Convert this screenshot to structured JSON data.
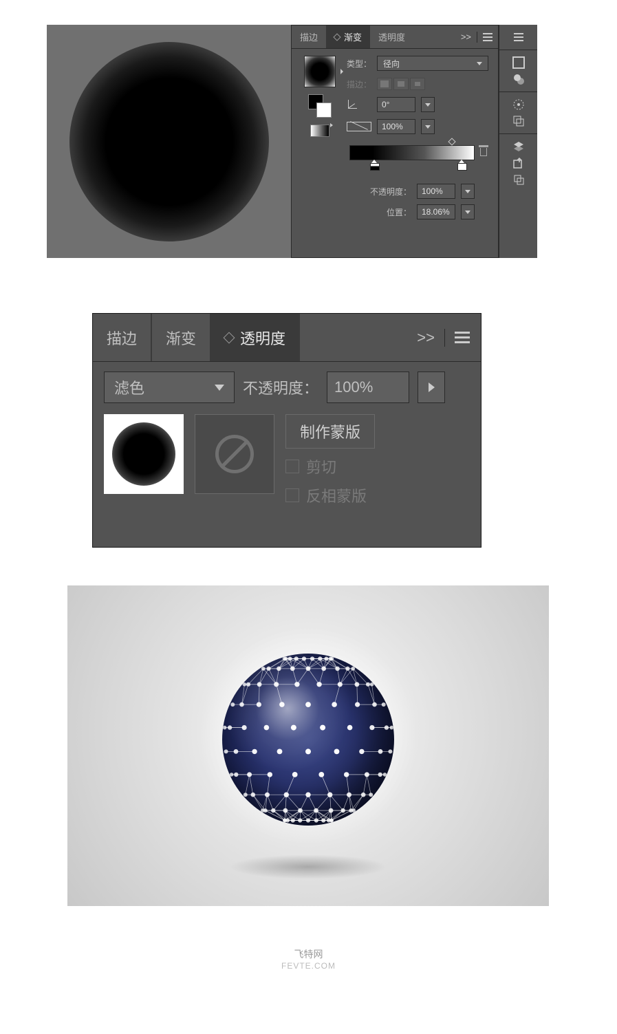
{
  "panel1": {
    "tabs": {
      "stroke": "描边",
      "gradient": "渐变",
      "transparency": "透明度"
    },
    "expand": ">>",
    "type_label": "类型：",
    "type_value": "径向",
    "stroke_label": "描边：",
    "angle_value": "0°",
    "aspect_value": "100%",
    "opacity_label": "不透明度：",
    "opacity_value": "100%",
    "position_label": "位置：",
    "position_value": "18.06%"
  },
  "panel2": {
    "tabs": {
      "stroke": "描边",
      "gradient": "渐变",
      "transparency": "透明度"
    },
    "expand": ">>",
    "blend_mode": "滤色",
    "opacity_label": "不透明度：",
    "opacity_value": "100%",
    "make_mask": "制作蒙版",
    "clip": "剪切",
    "invert": "反相蒙版"
  },
  "watermark": {
    "line1": "飞特网",
    "line2": "FEVTE.COM"
  }
}
